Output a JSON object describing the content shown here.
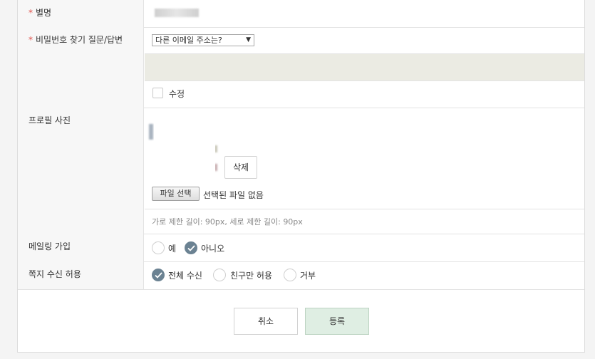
{
  "nickname": {
    "label": "별명",
    "required_mark": "*"
  },
  "password_qa": {
    "label": "비밀번호 찾기 질문/답변",
    "required_mark": "*",
    "question_selected": "다른 이메일 주소는?",
    "modify_label": "수정"
  },
  "profile_photo": {
    "label": "프로필 사진",
    "delete_label": "삭제",
    "file_button_label": "파일 선택",
    "file_status": "선택된 파일 없음",
    "size_hint": "가로 제한 길이: 90px, 세로 제한 길이: 90px"
  },
  "mailing": {
    "label": "메일링 가입",
    "options": [
      "예",
      "아니오"
    ],
    "selected": "아니오"
  },
  "message": {
    "label": "쪽지 수신 허용",
    "options": [
      "전체 수신",
      "친구만 허용",
      "거부"
    ],
    "selected": "전체 수신"
  },
  "actions": {
    "cancel_label": "취소",
    "submit_label": "등록"
  },
  "colors": {
    "accent": "#6b8292",
    "required": "#e0514b",
    "submit_bg": "#dfeee3"
  }
}
